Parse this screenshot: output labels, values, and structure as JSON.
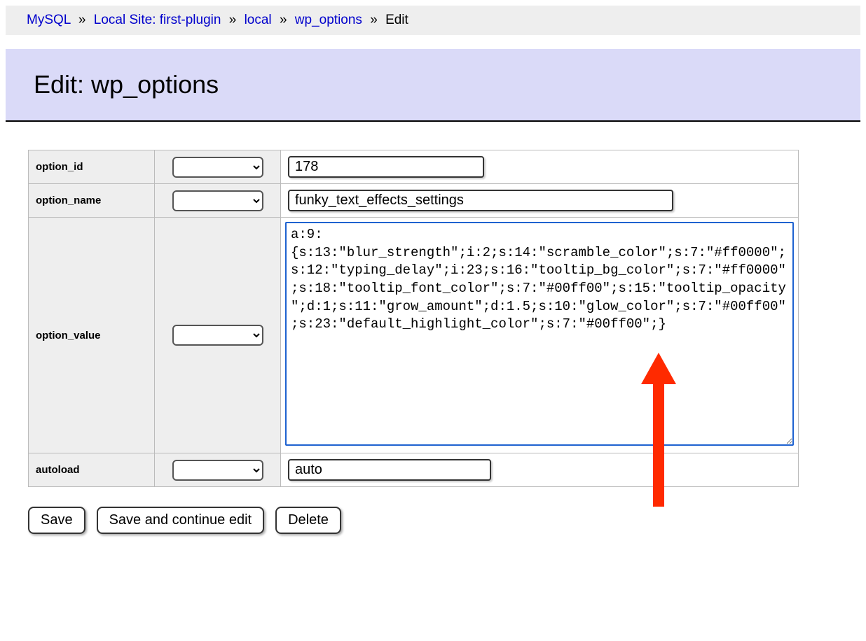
{
  "breadcrumb": {
    "items": [
      {
        "label": "MySQL",
        "link": true
      },
      {
        "label": "Local Site: first-plugin",
        "link": true
      },
      {
        "label": "local",
        "link": true
      },
      {
        "label": "wp_options",
        "link": true
      },
      {
        "label": "Edit",
        "link": false
      }
    ],
    "separator": "»"
  },
  "header": {
    "title": "Edit: wp_options"
  },
  "form": {
    "rows": {
      "option_id": {
        "label": "option_id",
        "value": "178"
      },
      "option_name": {
        "label": "option_name",
        "value": "funky_text_effects_settings"
      },
      "option_value": {
        "label": "option_value",
        "value": "a:9:{s:13:\"blur_strength\";i:2;s:14:\"scramble_color\";s:7:\"#ff0000\";s:12:\"typing_delay\";i:23;s:16:\"tooltip_bg_color\";s:7:\"#ff0000\";s:18:\"tooltip_font_color\";s:7:\"#00ff00\";s:15:\"tooltip_opacity\";d:1;s:11:\"grow_amount\";d:1.5;s:10:\"glow_color\";s:7:\"#00ff00\";s:23:\"default_highlight_color\";s:7:\"#00ff00\";}"
      },
      "autoload": {
        "label": "autoload",
        "value": "auto"
      }
    }
  },
  "buttons": {
    "save": "Save",
    "save_continue": "Save and continue edit",
    "delete": "Delete"
  },
  "annotation": {
    "arrow_color": "#ff2a00"
  }
}
